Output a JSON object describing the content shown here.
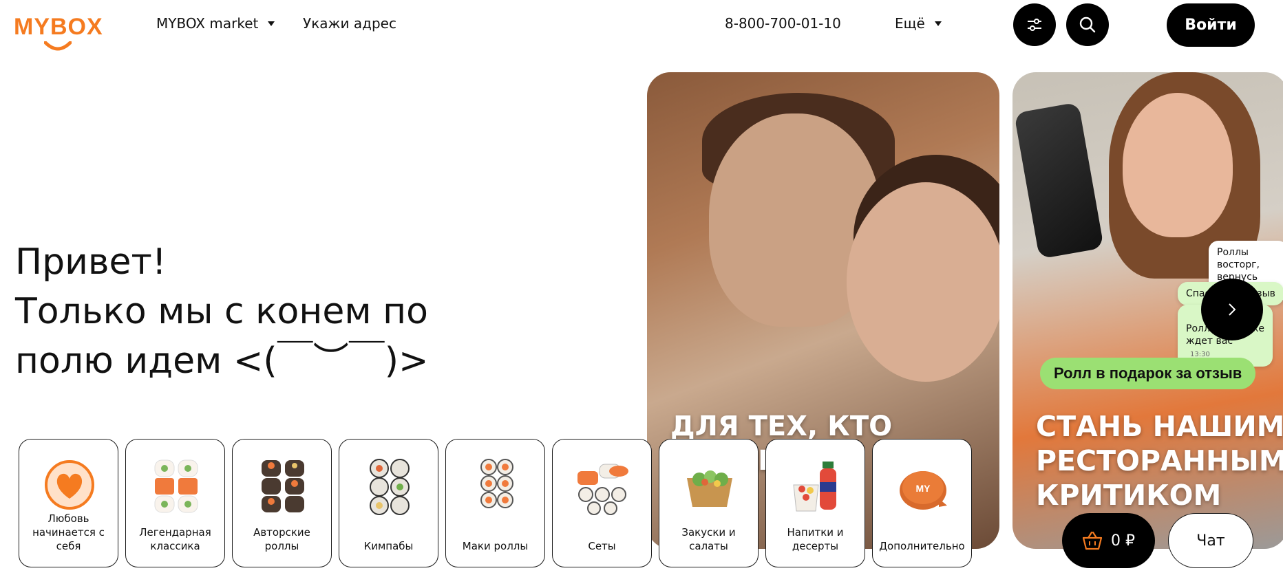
{
  "header": {
    "logo_text": "MYBOX",
    "market_label": "MYBOX market",
    "address_label": "Укажи адрес",
    "phone": "8-800-700-01-10",
    "more_label": "Ещё",
    "login_label": "Войти"
  },
  "greeting": {
    "text": "Привет!\nТолько мы с конем по\nполю идем <(￣︶￣)>"
  },
  "banners": [
    {
      "caption": "ДЛЯ ТЕХ, КТО ДЕЛАЕТ\n\n"
    },
    {
      "caption": "СТАНЬ НАШИМ\nРЕСТОРАННЫМ\nКРИТИКОМ",
      "promo": "Ролл в подарок за отзыв",
      "chat_1": "Роллы восторг,\nвернусь еще 🧡",
      "chat_2": "Спасибо за отзыв",
      "chat_3": "Ролл в подарке\nждет вас",
      "chat_time": "13:30"
    }
  ],
  "categories": [
    {
      "label": "Любовь\nначинается с\nсебя",
      "icon": "heart-icon"
    },
    {
      "label": "Легендарная\nклассика",
      "icon": "rolls-icon"
    },
    {
      "label": "Авторские\nроллы",
      "icon": "rolls-icon"
    },
    {
      "label": "Кимпабы",
      "icon": "rolls-icon"
    },
    {
      "label": "Маки роллы",
      "icon": "rolls-icon"
    },
    {
      "label": "Сеты",
      "icon": "rolls-icon"
    },
    {
      "label": "Закуски и\nсалаты",
      "icon": "salad-icon"
    },
    {
      "label": "Напитки и\nдесерты",
      "icon": "drink-icon"
    },
    {
      "label": "Дополнительно",
      "icon": "sauce-icon"
    }
  ],
  "cart": {
    "amount": "0 ₽"
  },
  "chat_label": "Чат",
  "colors": {
    "brand": "#f57b20",
    "dark": "#000000",
    "promo_green": "#9be073"
  }
}
